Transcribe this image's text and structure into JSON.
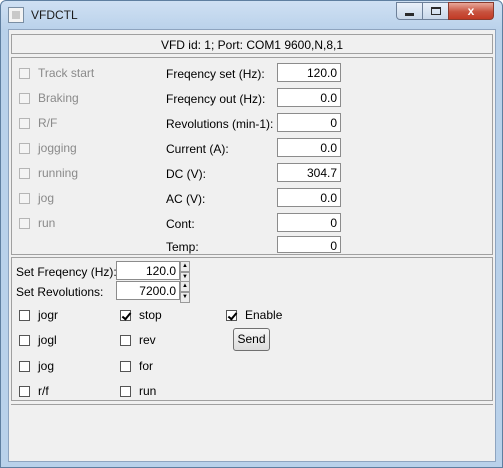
{
  "window": {
    "title": "VFDCTL",
    "close_glyph": "x"
  },
  "status": "VFD id: 1; Port: COM1 9600,N,8,1",
  "indicators": [
    "Track start",
    "Braking",
    "R/F",
    "jogging",
    "running",
    "jog",
    "run"
  ],
  "readouts": [
    {
      "label": "Freqency set (Hz):",
      "value": "120.0"
    },
    {
      "label": "Freqency out (Hz):",
      "value": "0.0"
    },
    {
      "label": "Revolutions (min-1):",
      "value": "0"
    },
    {
      "label": "Current (A):",
      "value": "0.0"
    },
    {
      "label": "DC (V):",
      "value": "304.7"
    },
    {
      "label": "AC (V):",
      "value": "0.0"
    },
    {
      "label": "Cont:",
      "value": "0"
    },
    {
      "label": "Temp:",
      "value": "0"
    }
  ],
  "setters": [
    {
      "label": "Set Freqency (Hz):",
      "value": "120.0"
    },
    {
      "label": "Set Revolutions:",
      "value": "7200.0"
    }
  ],
  "controls_col1": [
    {
      "label": "jogr",
      "checked": false
    },
    {
      "label": "jogl",
      "checked": false
    },
    {
      "label": "jog",
      "checked": false
    },
    {
      "label": "r/f",
      "checked": false
    }
  ],
  "controls_col2": [
    {
      "label": "stop",
      "checked": true
    },
    {
      "label": "rev",
      "checked": false
    },
    {
      "label": "for",
      "checked": false
    },
    {
      "label": "run",
      "checked": false
    }
  ],
  "enable": {
    "label": "Enable",
    "checked": true
  },
  "send_label": "Send",
  "icons": {
    "spin_up": "▲",
    "spin_down": "▼"
  }
}
